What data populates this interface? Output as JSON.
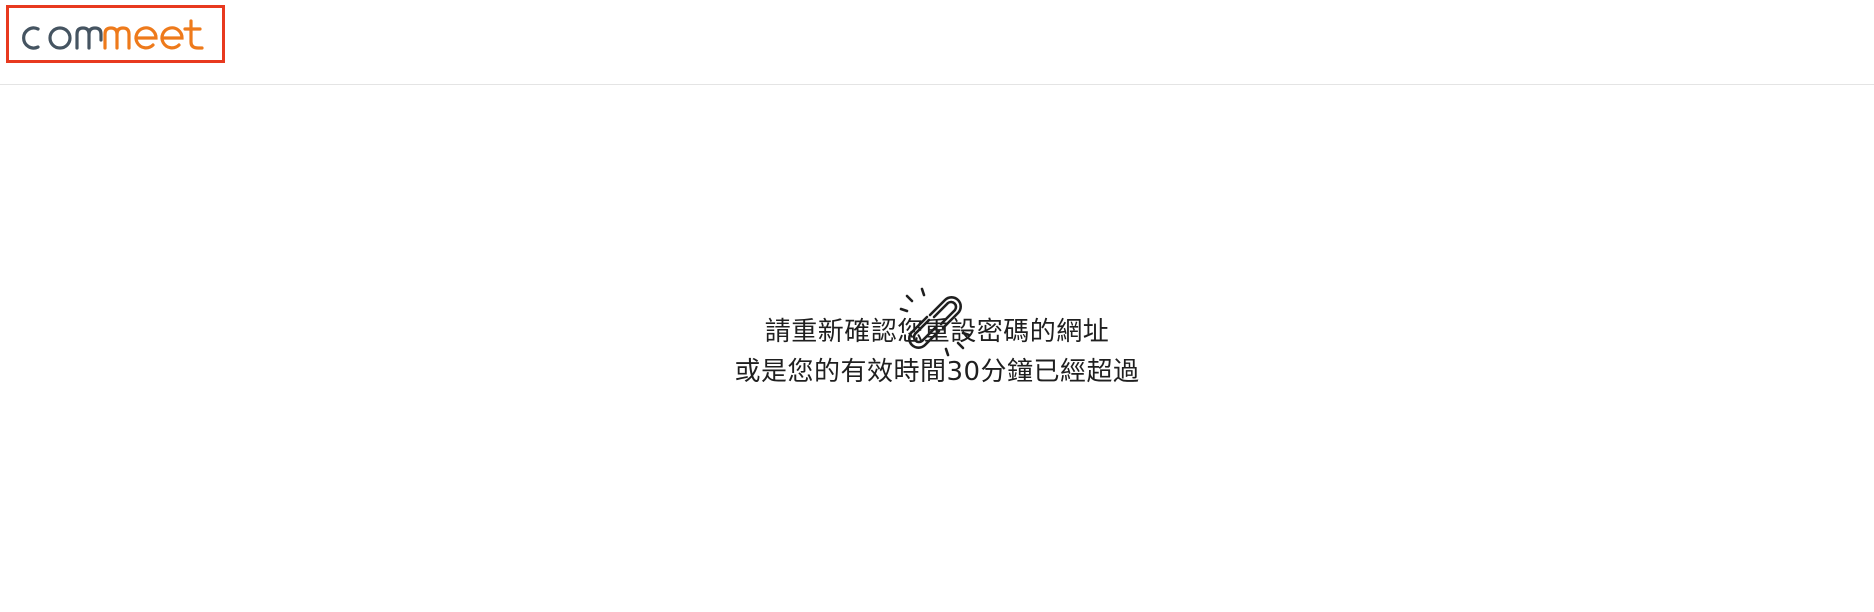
{
  "header": {
    "logo": {
      "text_part1": "com",
      "text_part2": "meet",
      "color_dark": "#455461",
      "color_orange": "#ee7a1b",
      "highlight_border": "#e8391f"
    }
  },
  "main": {
    "icon": "broken-link-icon",
    "message_line1": "請重新確認您重設密碼的網址",
    "message_line2": "或是您的有效時間30分鐘已經超過"
  }
}
